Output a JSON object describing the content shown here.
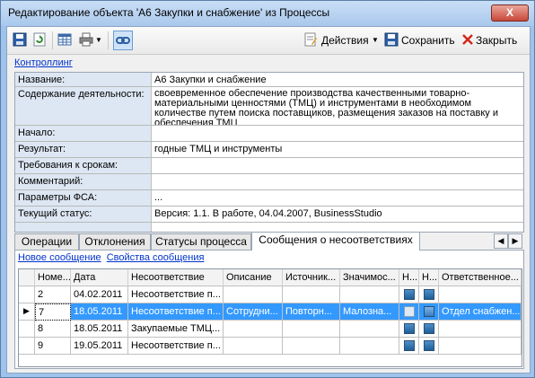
{
  "window": {
    "title": "Редактирование объекта 'А6 Закупки и снабжение' из Процессы",
    "close_glyph": "X"
  },
  "toolbar": {
    "actions_label": "Действия",
    "save_label": "Сохранить",
    "close_label": "Закрыть"
  },
  "controlling_link": "Контроллинг",
  "properties": [
    {
      "label": "Название:",
      "value": "А6 Закупки и снабжение"
    },
    {
      "label": "Содержание деятельности:",
      "value": "своевременное обеспечение производства качественными товарно-материальными ценностями (ТМЦ) и инструментами в необходимом количестве путем поиска поставщиков, размещения заказов на поставку и обеспечения ТМЦ"
    },
    {
      "label": "Начало:",
      "value": ""
    },
    {
      "label": "Результат:",
      "value": "годные ТМЦ и инструменты"
    },
    {
      "label": "Требования к срокам:",
      "value": ""
    },
    {
      "label": "Комментарий:",
      "value": ""
    },
    {
      "label": "Параметры ФСА:",
      "value": "..."
    },
    {
      "label": "Текущий статус:",
      "value": "Версия: 1.1. В работе, 04.04.2007, BusinessStudio"
    }
  ],
  "tabs": [
    "Операции",
    "Отклонения",
    "Статусы процесса",
    "Сообщения о несоответствиях"
  ],
  "active_tab": 3,
  "sublinks": {
    "new_message": "Новое сообщение",
    "message_properties": "Свойства сообщения"
  },
  "grid": {
    "columns": [
      "Номе...",
      "Дата",
      "Несоответствие",
      "Описание",
      "Источник...",
      "Значимос...",
      "Н...",
      "Н...",
      "Ответственное..."
    ],
    "rows": [
      {
        "num": "2",
        "date": "04.02.2011",
        "issue": "Несоответствие п...",
        "desc": "",
        "source": "",
        "sig": "",
        "c1": true,
        "c2": true,
        "resp": "",
        "selected": false
      },
      {
        "num": "7",
        "date": "18.05.2011",
        "issue": "Несоответствие п...",
        "desc": "Сотрудни...",
        "source": "Повторн...",
        "sig": "Малозна...",
        "c1": false,
        "c2": true,
        "resp": "Отдел снабжен...",
        "selected": true
      },
      {
        "num": "8",
        "date": "18.05.2011",
        "issue": "Закупаемые ТМЦ...",
        "desc": "",
        "source": "",
        "sig": "",
        "c1": true,
        "c2": true,
        "resp": "",
        "selected": false
      },
      {
        "num": "9",
        "date": "19.05.2011",
        "issue": "Несоответствие п...",
        "desc": "",
        "source": "",
        "sig": "",
        "c1": true,
        "c2": true,
        "resp": "",
        "selected": false
      }
    ]
  }
}
